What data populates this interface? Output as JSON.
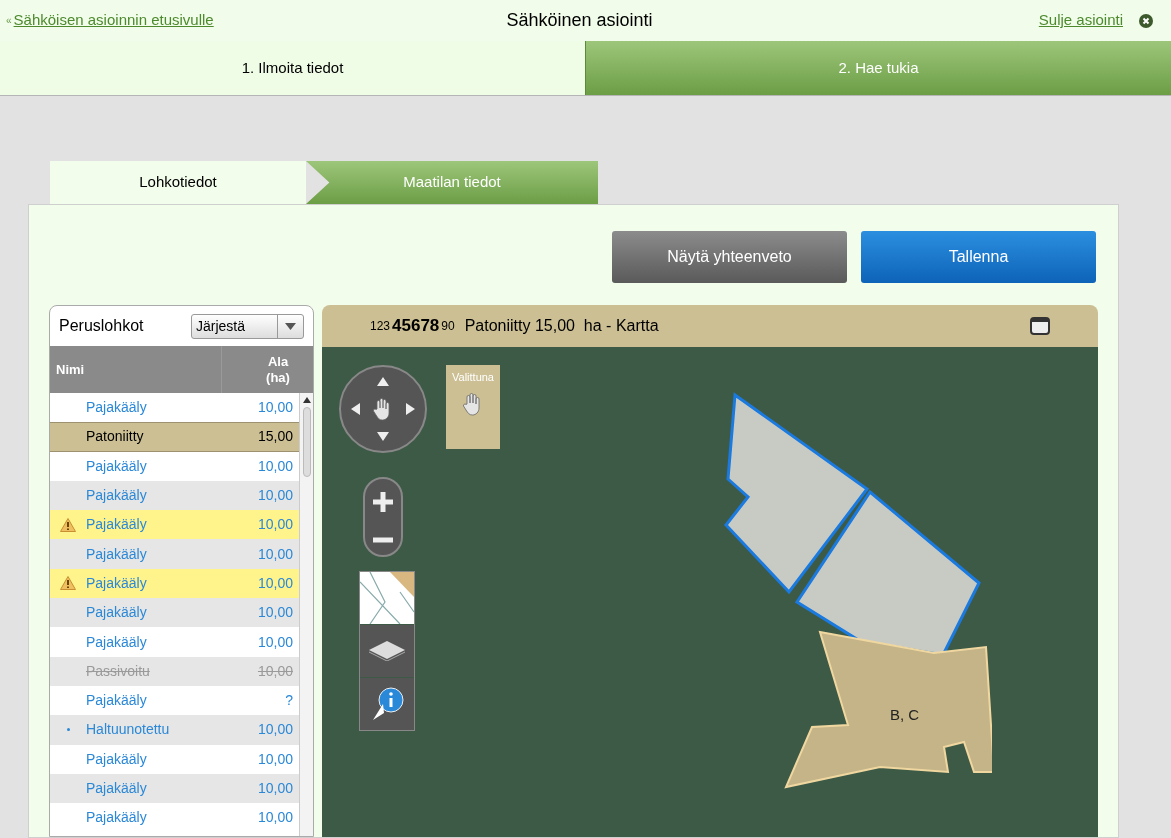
{
  "header": {
    "back_link_mark": "«",
    "back_link": "Sähköisen asioinnin etusivulle",
    "title": "Sähköinen asiointi",
    "close_link": "Sulje asiointi"
  },
  "steps": [
    {
      "label": "1. Ilmoita tiedot",
      "selected": true
    },
    {
      "label": "2. Hae tukia",
      "selected": false
    }
  ],
  "subtabs": [
    {
      "label": "Lohkotiedot",
      "selected": true
    },
    {
      "label": "Maatilan tiedot",
      "selected": false
    }
  ],
  "buttons": [
    {
      "label": "Näytä yhteenveto",
      "kind": "secondary"
    },
    {
      "label": "Tallenna",
      "kind": "primary"
    }
  ],
  "parcel_list": {
    "title": "Peruslohkot",
    "sort_select": "Järjestä",
    "columns": [
      "Nimi",
      "Ala (ha)"
    ],
    "rows": [
      {
        "name": "Pajakääly",
        "area": "10,00",
        "selected": false,
        "kind": "normal"
      },
      {
        "name": "Patoniitty",
        "area": "15,00",
        "selected": true,
        "kind": "normal"
      },
      {
        "name": "Pajakääly",
        "area": "10,00",
        "selected": false,
        "kind": "normal"
      },
      {
        "name": "Pajakääly",
        "area": "10,00",
        "selected": false,
        "kind": "normal"
      },
      {
        "name": "Pajakääly",
        "area": "10,00",
        "selected": false,
        "kind": "warning"
      },
      {
        "name": "Pajakääly",
        "area": "10,00",
        "selected": false,
        "kind": "normal"
      },
      {
        "name": "Pajakääly",
        "area": "10,00",
        "selected": false,
        "kind": "warning"
      },
      {
        "name": "Pajakääly",
        "area": "10,00",
        "selected": false,
        "kind": "normal"
      },
      {
        "name": "Pajakääly",
        "area": "10,00",
        "selected": false,
        "kind": "normal"
      },
      {
        "name": "Passivoitu",
        "area": "10,00",
        "selected": false,
        "kind": "passive"
      },
      {
        "name": "Pajakääly",
        "area": "?",
        "selected": false,
        "kind": "normal"
      },
      {
        "name": "Haltuunotettu",
        "area": "10,00",
        "selected": false,
        "kind": "new"
      },
      {
        "name": "Pajakääly",
        "area": "10,00",
        "selected": false,
        "kind": "normal"
      },
      {
        "name": "Pajakääly",
        "area": "10,00",
        "selected": false,
        "kind": "normal"
      },
      {
        "name": "Pajakääly",
        "area": "10,00",
        "selected": false,
        "kind": "normal"
      }
    ]
  },
  "map": {
    "id_prefix": "123",
    "id_main": "45678",
    "id_suffix": "90",
    "title": "Patoniitty 15,00  ha - Kartta",
    "selected_tool_label": "Valittuna",
    "parcel_label": "B, C"
  }
}
